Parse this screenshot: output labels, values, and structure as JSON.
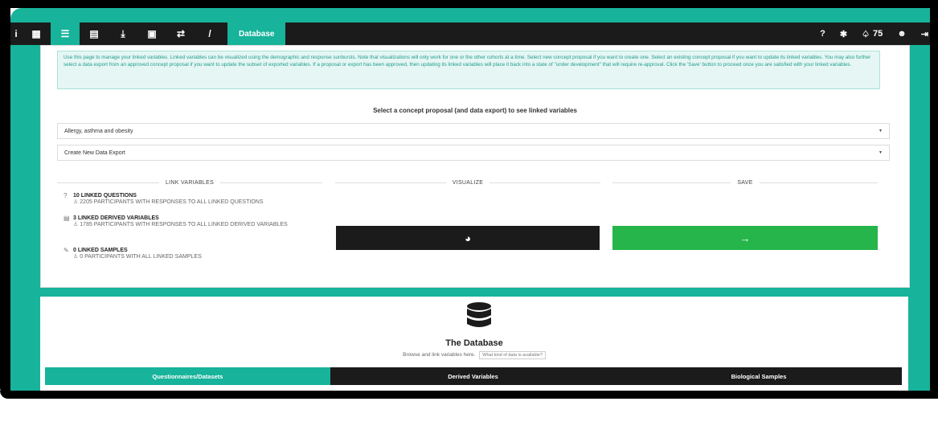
{
  "navbar": {
    "left_icons": [
      {
        "name": "info-icon",
        "glyph": "i"
      },
      {
        "name": "grid-icon",
        "glyph": "▦"
      },
      {
        "name": "database-icon",
        "glyph": "☰",
        "active": true
      },
      {
        "name": "document-icon",
        "glyph": "▤"
      },
      {
        "name": "download-icon",
        "glyph": "⤓"
      },
      {
        "name": "save-icon",
        "glyph": "▣"
      },
      {
        "name": "exchange-icon",
        "glyph": "⇄"
      },
      {
        "name": "slash-icon",
        "glyph": "/"
      }
    ],
    "active_tab": "Database",
    "right": {
      "help_glyph": "?",
      "bug_glyph": "✱",
      "bell_glyph": "♤",
      "notification_count": "75",
      "user_glyph": "☻",
      "logout_glyph": "⇥"
    }
  },
  "info_text": "Use this page to manage your linked variables. Linked variables can be visualized using the demographic and response sunbursts. Note that visualizations will only work for one or the other cohorts at a time. Select new concept proposal if you want to create one. Select an existing concept proposal if you want to update its linked variables. You may also further select a data export from an approved concept proposal if you want to update the subset of exported variables. If a proposal or export has been approved, then updating its linked variables will place it back into a state of \"under development\" that will require re-approval. Click the 'Save' button to proceed once you are satisfied with your linked variables.",
  "select_title": "Select a concept proposal (and data export) to see linked variables",
  "concept_dropdown": "Allergy, asthma and obesity",
  "export_dropdown": "Create New Data Export",
  "sections": {
    "link": "LINK VARIABLES",
    "visualize": "VISUALIZE",
    "save": "SAVE"
  },
  "linked": {
    "questions_title": "10 LINKED QUESTIONS",
    "questions_sub": "2205 PARTICIPANTS WITH RESPONSES TO ALL LINKED QUESTIONS",
    "derived_title": "3 LINKED DERIVED VARIABLES",
    "derived_sub": "1785 PARTICIPANTS WITH RESPONSES TO ALL LINKED DERIVED VARIABLES",
    "samples_title": "0 LINKED SAMPLES",
    "samples_sub": "0 PARTICIPANTS WITH ALL LINKED SAMPLES"
  },
  "buttons": {
    "visualize_glyph": "◕",
    "save_glyph": "→"
  },
  "database": {
    "title": "The Database",
    "subtitle": "Browse and link variables here.",
    "hint": "What kind of data is available?",
    "tabs": [
      "Questionnaires/Datasets",
      "Derived Variables",
      "Biological Samples"
    ]
  }
}
